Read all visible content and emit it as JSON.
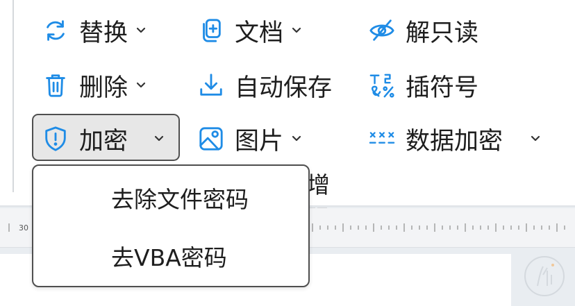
{
  "ribbon": {
    "row1": [
      {
        "label": "替换",
        "icon": "refresh-icon",
        "has_dropdown": true
      },
      {
        "label": "文档",
        "icon": "document-add-icon",
        "has_dropdown": true
      },
      {
        "label": "解只读",
        "icon": "eye-off-icon",
        "has_dropdown": false
      }
    ],
    "row2": [
      {
        "label": "删除",
        "icon": "trash-icon",
        "has_dropdown": true
      },
      {
        "label": "自动保存",
        "icon": "download-icon",
        "has_dropdown": false
      },
      {
        "label": "插符号",
        "icon": "symbols-icon",
        "has_dropdown": false
      }
    ],
    "row3": [
      {
        "label": "加密",
        "icon": "shield-alert-icon",
        "has_dropdown": true
      },
      {
        "label": "图片",
        "icon": "image-icon",
        "has_dropdown": true
      },
      {
        "label": "数据加密",
        "icon": "asterisks-icon",
        "has_dropdown": true
      }
    ],
    "partial_label": "增强"
  },
  "dropdown": {
    "items": [
      {
        "label": "去除文件密码"
      },
      {
        "label": "去VBA密码"
      }
    ]
  },
  "ruler": {
    "label": "30"
  },
  "colors": {
    "accent": "#1f8ce6",
    "active_bg": "#e7e7e7",
    "border": "#4f4f4f"
  }
}
